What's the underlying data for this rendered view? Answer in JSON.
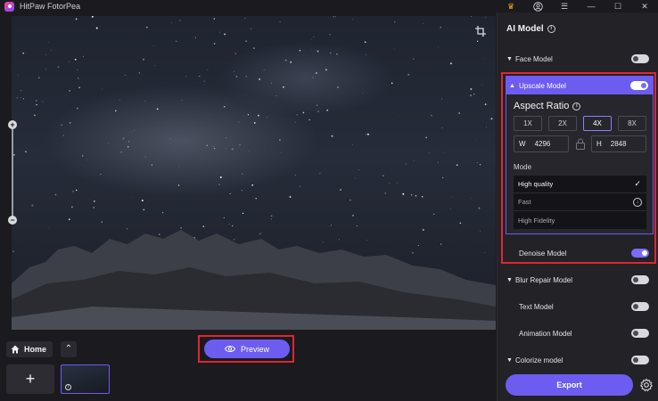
{
  "app": {
    "title": "HitPaw FotorPea"
  },
  "titlebar": {
    "icons": [
      "crown-icon",
      "user-icon",
      "menu-icon",
      "minimize-icon",
      "maximize-icon",
      "close-icon"
    ]
  },
  "bottom": {
    "home_label": "Home",
    "preview_label": "Preview"
  },
  "panel": {
    "title": "AI Model",
    "models": {
      "face": {
        "label": "Face Model",
        "enabled": false
      },
      "upscale": {
        "label": "Upscale Model",
        "enabled": true
      },
      "denoise": {
        "label": "Denoise Model",
        "enabled": true
      },
      "blur_repair": {
        "label": "Blur Repair Model",
        "enabled": false
      },
      "text": {
        "label": "Text Model",
        "enabled": false
      },
      "animation": {
        "label": "Animation Model",
        "enabled": false
      },
      "colorize": {
        "label": "Colorize model",
        "enabled": false
      }
    },
    "upscale": {
      "aspect_title": "Aspect Ratio",
      "ratios": [
        "1X",
        "2X",
        "4X",
        "8X"
      ],
      "selected_ratio": "4X",
      "width_label": "W",
      "width_value": "4296",
      "height_label": "H",
      "height_value": "2848",
      "mode_label": "Mode",
      "modes": [
        "High quality",
        "Fast",
        "High Fidelity"
      ],
      "selected_mode": "High quality"
    },
    "export_label": "Export"
  },
  "colors": {
    "accent": "#6c5cf0",
    "highlight": "#e0262f",
    "panel_bg": "#222227"
  }
}
